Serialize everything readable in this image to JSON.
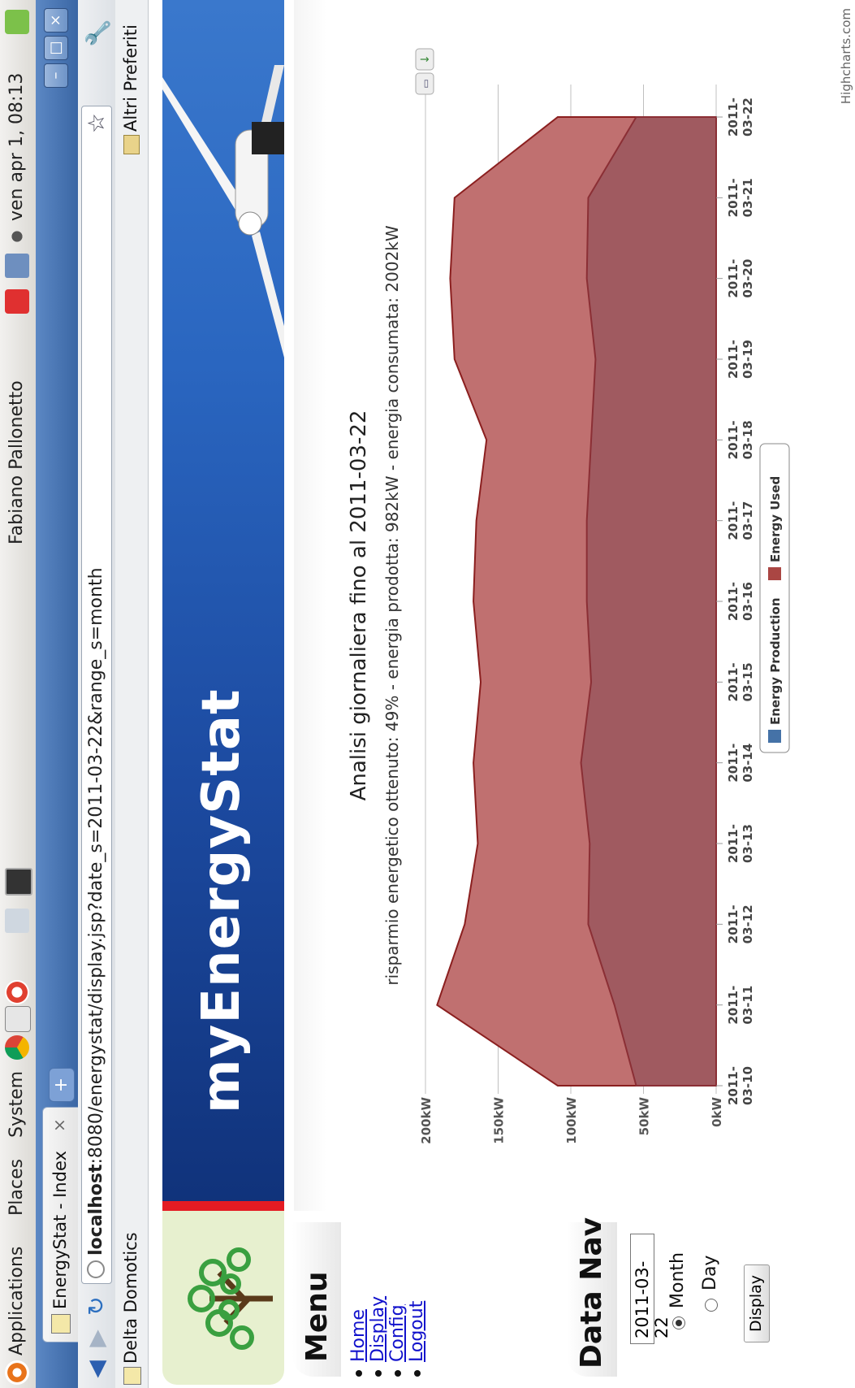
{
  "gnome_panel": {
    "menus": [
      "Applications",
      "Places",
      "System"
    ],
    "user": "Fabiano Pallonetto",
    "clock": "ven apr  1, 08:13"
  },
  "browser": {
    "tab_title": "EnergyStat - Index",
    "tab_close": "×",
    "new_tab": "+",
    "url": "localhost:8080/energystat/display.jsp?date_s=2011-03-22&range_s=month",
    "url_host": "localhost",
    "url_rest": ":8080/energystat/display.jsp?date_s=2011-03-22&range_s=month",
    "bookmark_left": "Delta Domotics",
    "bookmark_right": "Altri Preferiti",
    "colors": {
      "titlebar": "#4a74b4"
    }
  },
  "page": {
    "brand": "myEnergyStat",
    "menu": {
      "title": "Menu",
      "links": [
        "Home",
        "Display",
        "Config",
        "Logout"
      ]
    },
    "data_nav": {
      "title": "Data Nav",
      "date_value": "2011-03-22",
      "range_month": "Month",
      "range_day": "Day",
      "range_selected": "month",
      "display_button": "Display"
    },
    "credit": "Highcharts.com"
  },
  "chart_data": {
    "type": "area",
    "title": "Analisi giornaliera fino al 2011-03-22",
    "subtitle": "risparmio energetico ottenuto: 49% - energia prodotta: 982kW - energia consumata: 2002kW",
    "ylabel": "kW",
    "ylim": [
      0,
      200
    ],
    "yticks": [
      "0kW",
      "50kW",
      "100kW",
      "150kW",
      "200kW"
    ],
    "categories": [
      "2011-03-10",
      "2011-03-11",
      "2011-03-12",
      "2011-03-13",
      "2011-03-14",
      "2011-03-15",
      "2011-03-16",
      "2011-03-17",
      "2011-03-18",
      "2011-03-19",
      "2011-03-20",
      "2011-03-21",
      "2011-03-22"
    ],
    "legend": [
      "Energy Production",
      "Energy Used"
    ],
    "legend_colors": [
      "#4572a7",
      "#aa4643"
    ],
    "series": [
      {
        "name": "Energy Used",
        "values": [
          109,
          192,
          173,
          164,
          167,
          162,
          167,
          165,
          158,
          180,
          183,
          180,
          109
        ],
        "fill": "#c07070",
        "stroke": "#8b1f1f"
      },
      {
        "name": "Energy Production",
        "values": [
          55,
          70,
          88,
          87,
          93,
          86,
          89,
          89,
          86,
          83,
          89,
          88,
          55
        ],
        "fill": "#a05a60",
        "stroke": "#8b2f35"
      }
    ],
    "grid": true,
    "legend_position": "bottom"
  }
}
